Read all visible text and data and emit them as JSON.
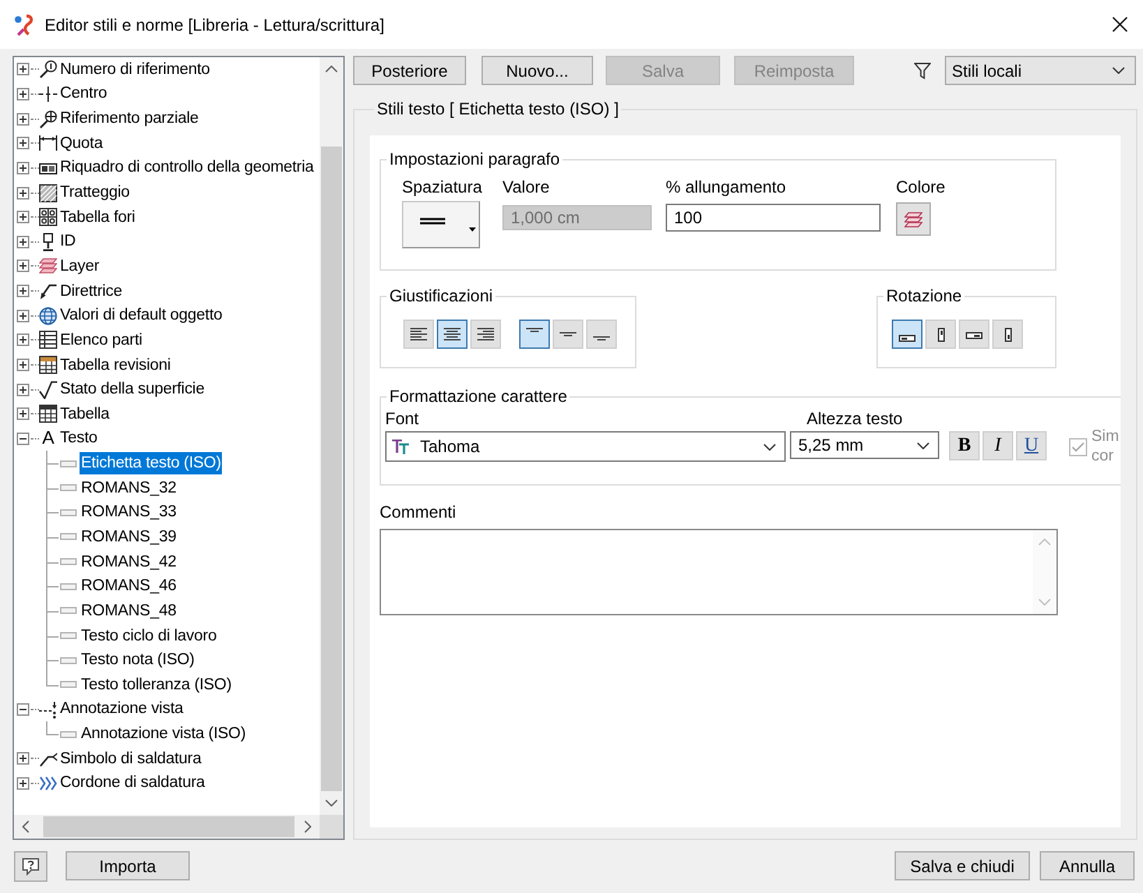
{
  "window": {
    "title": "Editor stili e norme [Libreria - Lettura/scrittura]"
  },
  "tree": {
    "items": [
      {
        "label": "Numero di riferimento",
        "expanded": false,
        "selected": false
      },
      {
        "label": "Centro",
        "expanded": false,
        "selected": false
      },
      {
        "label": "Riferimento parziale",
        "expanded": false,
        "selected": false
      },
      {
        "label": "Quota",
        "expanded": false,
        "selected": false
      },
      {
        "label": "Riquadro di controllo della geometria",
        "expanded": false,
        "selected": false
      },
      {
        "label": "Tratteggio",
        "expanded": false,
        "selected": false
      },
      {
        "label": "Tabella fori",
        "expanded": false,
        "selected": false
      },
      {
        "label": "ID",
        "expanded": false,
        "selected": false
      },
      {
        "label": "Layer",
        "expanded": false,
        "selected": false
      },
      {
        "label": "Direttrice",
        "expanded": false,
        "selected": false
      },
      {
        "label": "Valori di default oggetto",
        "expanded": false,
        "selected": false
      },
      {
        "label": "Elenco parti",
        "expanded": false,
        "selected": false
      },
      {
        "label": "Tabella revisioni",
        "expanded": false,
        "selected": false
      },
      {
        "label": "Stato della superficie",
        "expanded": false,
        "selected": false
      },
      {
        "label": "Tabella",
        "expanded": false,
        "selected": false
      },
      {
        "label": "Testo",
        "icon_text": "A",
        "expanded": true,
        "selected": false,
        "children": [
          {
            "label": "Etichetta testo (ISO)",
            "selected": true
          },
          {
            "label": "ROMANS_32",
            "selected": false
          },
          {
            "label": "ROMANS_33",
            "selected": false
          },
          {
            "label": "ROMANS_39",
            "selected": false
          },
          {
            "label": "ROMANS_42",
            "selected": false
          },
          {
            "label": "ROMANS_46",
            "selected": false
          },
          {
            "label": "ROMANS_48",
            "selected": false
          },
          {
            "label": "Testo ciclo di lavoro",
            "selected": false
          },
          {
            "label": "Testo nota (ISO)",
            "selected": false
          },
          {
            "label": "Testo tolleranza (ISO)",
            "selected": false
          }
        ]
      },
      {
        "label": "Annotazione vista",
        "expanded": true,
        "selected": false,
        "children": [
          {
            "label": "Annotazione vista (ISO)",
            "selected": false
          }
        ]
      },
      {
        "label": "Simbolo di saldatura",
        "expanded": false,
        "selected": false
      },
      {
        "label": "Cordone di saldatura",
        "expanded": false,
        "selected": false
      }
    ]
  },
  "toolbar": {
    "buttons": [
      {
        "label": "Posteriore",
        "disabled": false
      },
      {
        "label": "Nuovo...",
        "disabled": false
      },
      {
        "label": "Salva",
        "disabled": true
      },
      {
        "label": "Reimposta",
        "disabled": true
      }
    ],
    "filter": {
      "value": "Stili locali"
    }
  },
  "style_header": "Stili testo [ Etichetta testo (ISO) ]",
  "paragraph_settings": {
    "title": "Impostazioni paragrafo",
    "spacing": {
      "label": "Spaziatura"
    },
    "value": {
      "label": "Valore",
      "value": "1,000 cm",
      "disabled": true
    },
    "stretch": {
      "label": "% allungamento",
      "value": "100"
    },
    "color": {
      "label": "Colore"
    }
  },
  "justification": {
    "title": "Giustificazioni",
    "horizontal": [
      {
        "selected": false
      },
      {
        "selected": true
      },
      {
        "selected": false
      }
    ],
    "vertical": [
      {
        "selected": true
      },
      {
        "selected": false
      },
      {
        "selected": false
      }
    ]
  },
  "rotation": {
    "title": "Rotazione",
    "options": [
      {
        "selected": true
      },
      {
        "selected": false
      },
      {
        "selected": false
      },
      {
        "selected": false
      }
    ]
  },
  "character_formatting": {
    "title": "Formattazione carattere",
    "font": {
      "label": "Font",
      "value": "Tahoma"
    },
    "height": {
      "label": "Altezza testo",
      "value": "5,25 mm"
    },
    "styles": [
      {
        "label": "B",
        "selected": false
      },
      {
        "label": "I",
        "selected": false
      },
      {
        "label": "U",
        "selected": false
      }
    ],
    "option": {
      "label": "Sim cor",
      "checked": true,
      "disabled": true
    }
  },
  "comments": {
    "label": "Commenti"
  },
  "footer": {
    "import_button": "Importa",
    "buttons": [
      "Salva e chiudi",
      "Annulla"
    ]
  }
}
